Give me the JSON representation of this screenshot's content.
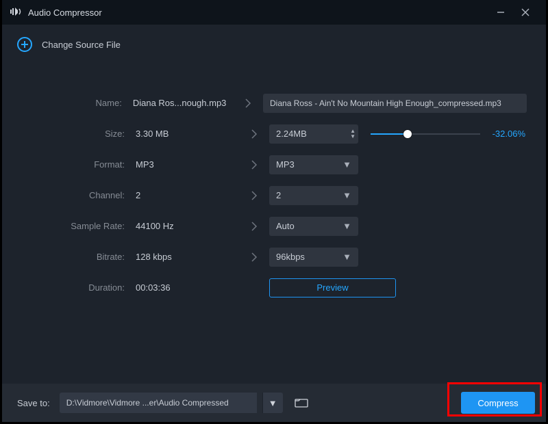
{
  "title": "Audio Compressor",
  "source_action": "Change Source File",
  "labels": {
    "name": "Name:",
    "size": "Size:",
    "format": "Format:",
    "channel": "Channel:",
    "sample_rate": "Sample Rate:",
    "bitrate": "Bitrate:",
    "duration": "Duration:"
  },
  "src": {
    "name": "Diana Ros...nough.mp3",
    "size": "3.30 MB",
    "format": "MP3",
    "channel": "2",
    "sample_rate": "44100 Hz",
    "bitrate": "128 kbps",
    "duration": "00:03:36"
  },
  "out": {
    "name": "Diana Ross - Ain't No Mountain High Enough_compressed.mp3",
    "size": "2.24MB",
    "format": "MP3",
    "channel": "2",
    "sample_rate": "Auto",
    "bitrate": "96kbps"
  },
  "size_slider": {
    "percent_fill": 34,
    "delta_label": "-32.06%"
  },
  "preview_label": "Preview",
  "footer": {
    "save_to_label": "Save to:",
    "path": "D:\\Vidmore\\Vidmore ...er\\Audio Compressed",
    "compress_label": "Compress"
  }
}
